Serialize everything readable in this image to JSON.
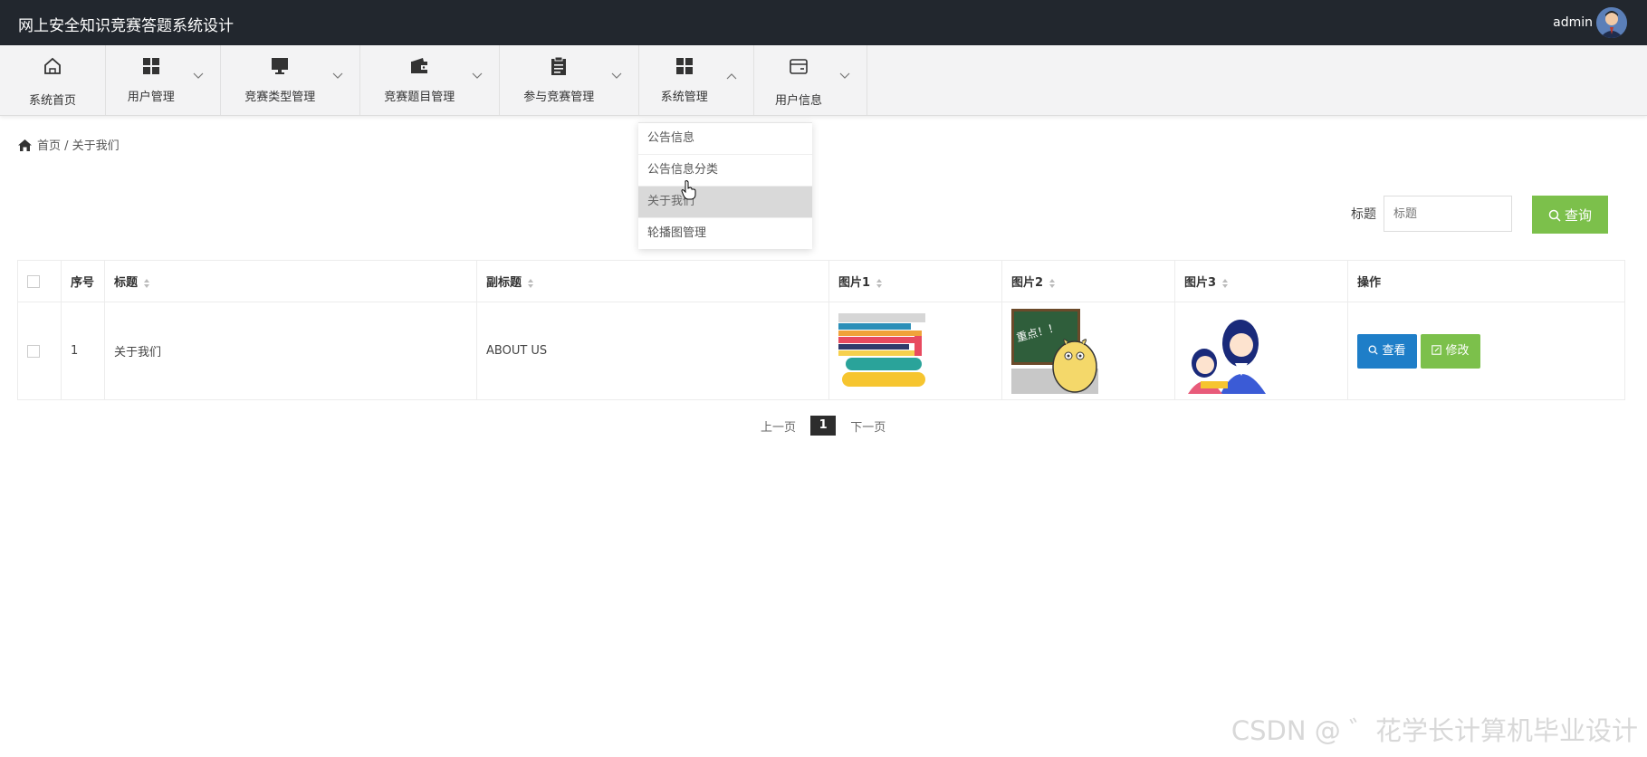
{
  "header": {
    "title": "网上安全知识竞赛答题系统设计",
    "user": "admin"
  },
  "nav": [
    {
      "label": "系统首页",
      "icon": "home-icon"
    },
    {
      "label": "用户管理",
      "icon": "grid-icon"
    },
    {
      "label": "竞赛类型管理",
      "icon": "monitor-icon"
    },
    {
      "label": "竞赛题目管理",
      "icon": "wallet-icon"
    },
    {
      "label": "参与竞赛管理",
      "icon": "clipboard-icon"
    },
    {
      "label": "系统管理",
      "icon": "grid-icon"
    },
    {
      "label": "用户信息",
      "icon": "card-icon"
    }
  ],
  "dropdown": [
    {
      "label": "公告信息"
    },
    {
      "label": "公告信息分类"
    },
    {
      "label": "关于我们"
    },
    {
      "label": "轮播图管理"
    }
  ],
  "breadcrumb": {
    "home": "首页",
    "sep": " / ",
    "current": "关于我们"
  },
  "search": {
    "label": "标题",
    "placeholder": "标题",
    "button": "查询"
  },
  "table": {
    "headers": [
      "序号",
      "标题",
      "副标题",
      "图片1",
      "图片2",
      "图片3",
      "操作"
    ],
    "rows": [
      {
        "index": "1",
        "title": "关于我们",
        "subtitle": "ABOUT US",
        "view": "查看",
        "edit": "修改"
      }
    ]
  },
  "pager": {
    "prev": "上一页",
    "current": "1",
    "next": "下一页"
  },
  "watermark": "CSDN @ ゛花学长计算机毕业设计"
}
